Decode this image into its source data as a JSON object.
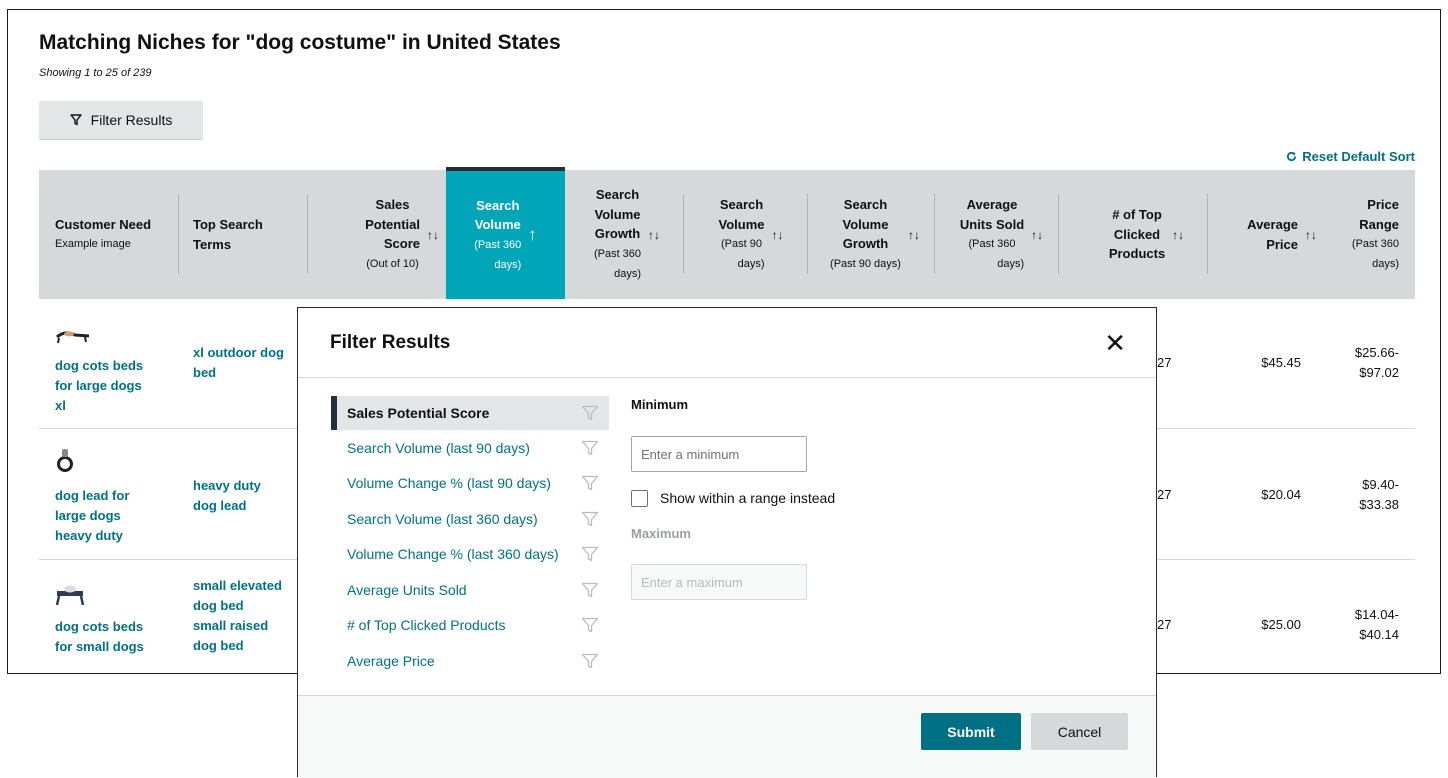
{
  "header": {
    "title": "Matching Niches for \"dog costume\" in United States",
    "showing": "Showing 1 to 25 of 239",
    "filter_button": "Filter Results",
    "reset_sort": "Reset Default Sort"
  },
  "table": {
    "columns": {
      "customer_need": {
        "main": "Customer Need",
        "sub": "Example image"
      },
      "top_search_terms": {
        "main_1": "Top Search",
        "main_2": "Terms"
      },
      "sales_potential": {
        "l1": "Sales",
        "l2": "Potential",
        "l3": "Score",
        "sub": "(Out of 10)"
      },
      "search_volume_360": {
        "l1": "Search",
        "l2": "Volume",
        "sub1": "(Past 360",
        "sub2": "days)"
      },
      "search_volume_growth_360": {
        "l1": "Search",
        "l2": "Volume",
        "l3": "Growth",
        "sub1": "(Past 360",
        "sub2": "days)"
      },
      "search_volume_90": {
        "l1": "Search",
        "l2": "Volume",
        "sub1": "(Past 90",
        "sub2": "days)"
      },
      "search_volume_growth_90": {
        "l1": "Search",
        "l2": "Volume",
        "l3": "Growth",
        "sub": "(Past 90 days)"
      },
      "avg_units_sold": {
        "l1": "Average",
        "l2": "Units Sold",
        "sub1": "(Past 360",
        "sub2": "days)"
      },
      "top_clicked": {
        "l1": "# of Top",
        "l2": "Clicked",
        "l3": "Products"
      },
      "avg_price": {
        "l1": "Average",
        "l2": "Price"
      },
      "price_range": {
        "l1": "Price",
        "l2": "Range",
        "sub1": "(Past 360",
        "sub2": "days)"
      }
    },
    "rows": [
      {
        "need": [
          "dog cots beds",
          "for large dogs",
          "xl"
        ],
        "terms": [
          "xl outdoor dog",
          "bed"
        ],
        "top_clicked_partial": "27",
        "avg_price": "$45.45",
        "price_range": [
          "$25.66-",
          "$97.02"
        ]
      },
      {
        "need": [
          "dog lead for",
          "large dogs",
          "heavy duty"
        ],
        "terms": [
          "heavy duty",
          "dog lead"
        ],
        "top_clicked_partial": "27",
        "avg_price": "$20.04",
        "price_range": [
          "$9.40-",
          "$33.38"
        ]
      },
      {
        "need": [
          "dog cots beds",
          "for small dogs"
        ],
        "terms": [
          "small elevated",
          "dog bed",
          "small raised",
          "dog bed"
        ],
        "top_clicked_partial": "27",
        "avg_price": "$25.00",
        "price_range": [
          "$14.04-",
          "$40.14"
        ]
      }
    ]
  },
  "modal": {
    "title": "Filter Results",
    "filters": [
      "Sales Potential Score",
      "Search Volume (last 90 days)",
      "Volume Change % (last 90 days)",
      "Search Volume (last 360 days)",
      "Volume Change % (last 360 days)",
      "Average Units Sold",
      "# of Top Clicked Products",
      "Average Price"
    ],
    "minimum_label": "Minimum",
    "minimum_placeholder": "Enter a minimum",
    "range_label": "Show within a range instead",
    "maximum_label": "Maximum",
    "maximum_placeholder": "Enter a maximum",
    "submit": "Submit",
    "cancel": "Cancel"
  },
  "colors": {
    "accent": "#007185",
    "active_column": "#00a5b8",
    "header_bg": "#d5d9d9",
    "dark_navy": "#232f3e"
  }
}
